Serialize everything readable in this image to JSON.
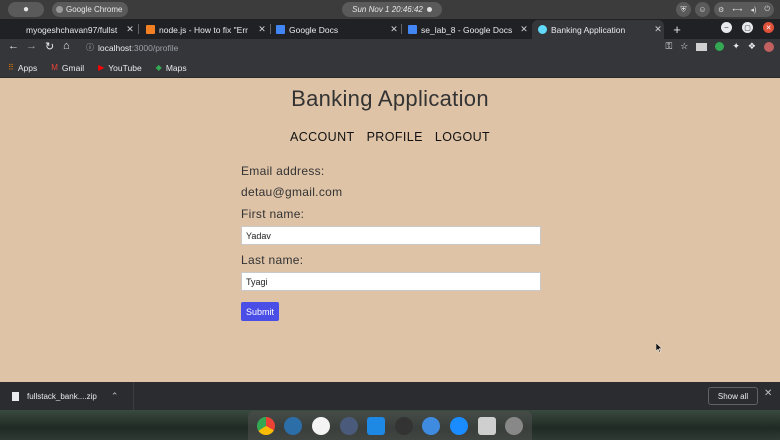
{
  "os": {
    "app_name": "Google Chrome",
    "clock": "Sun Nov 1  20:46:42"
  },
  "tabs": [
    {
      "title": "myogeshchavan97/fullst",
      "icon": "github-icon",
      "active": false
    },
    {
      "title": "node.js - How to fix \"Err",
      "icon": "stackoverflow-icon",
      "active": false
    },
    {
      "title": "Google Docs",
      "icon": "docs-icon",
      "active": false
    },
    {
      "title": "se_lab_8 - Google Docs",
      "icon": "docs-icon",
      "active": false
    },
    {
      "title": "Banking Application",
      "icon": "react-icon",
      "active": true
    }
  ],
  "address": {
    "host": "localhost",
    "path": ":3000/profile"
  },
  "bookmarks": [
    {
      "label": "Apps",
      "icon": "apps-grid-icon"
    },
    {
      "label": "Gmail",
      "icon": "gmail-icon"
    },
    {
      "label": "YouTube",
      "icon": "youtube-icon"
    },
    {
      "label": "Maps",
      "icon": "maps-icon"
    }
  ],
  "page": {
    "title": "Banking Application",
    "nav": [
      "ACCOUNT",
      "PROFILE",
      "LOGOUT"
    ],
    "email_label": "Email address:",
    "email_value": "detau@gmail.com",
    "first_name_label": "First name:",
    "first_name_value": "Yadav",
    "last_name_label": "Last name:",
    "last_name_value": "Tyagi",
    "submit_label": "Submit"
  },
  "downloads": {
    "file_name": "fullstack_bank....zip",
    "show_all": "Show all"
  },
  "colors": {
    "page_background": "#dec3a7",
    "submit_button": "#4a4de6"
  }
}
